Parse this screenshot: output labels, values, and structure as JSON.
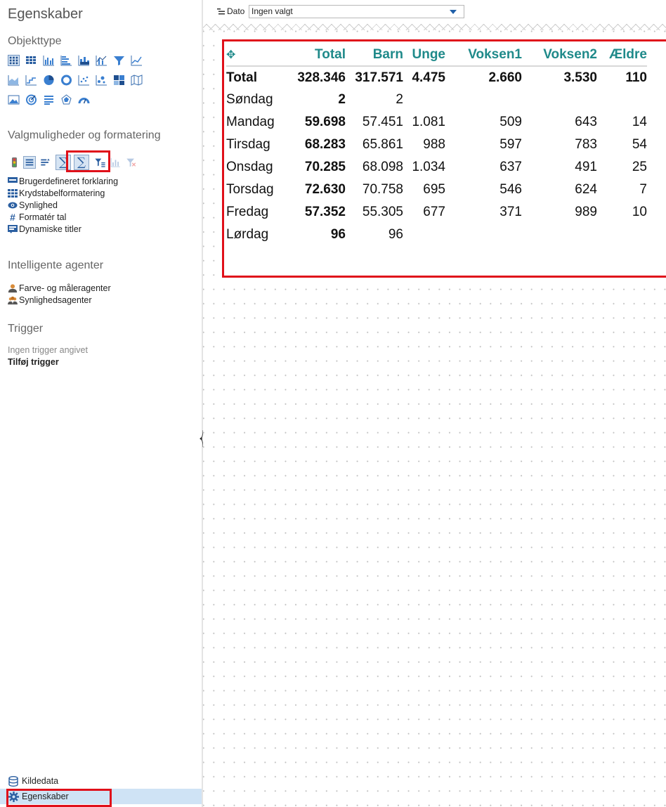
{
  "sidebar": {
    "title": "Egenskaber",
    "object_type_title": "Objekttype",
    "options_title": "Valgmuligheder og formatering",
    "links": [
      {
        "label": "Brugerdefineret forklaring",
        "icon": "legend-icon"
      },
      {
        "label": "Krydstabelformatering",
        "icon": "grid-icon"
      },
      {
        "label": "Synlighed",
        "icon": "eye-icon"
      },
      {
        "label": "Formatér tal",
        "icon": "hash-icon"
      },
      {
        "label": "Dynamiske titler",
        "icon": "titles-icon"
      }
    ],
    "agents_title": "Intelligente agenter",
    "agents": [
      {
        "label": "Farve- og måleragenter",
        "icon": "agent-icon"
      },
      {
        "label": "Synlighedsagenter",
        "icon": "agents-group-icon"
      }
    ],
    "trigger_title": "Trigger",
    "trigger_empty": "Ingen trigger angivet",
    "trigger_add": "Tilføj trigger",
    "bottom_nav": [
      {
        "label": "Kildedata",
        "icon": "database-icon"
      },
      {
        "label": "Egenskaber",
        "icon": "gear-icon",
        "active": true
      }
    ]
  },
  "filter": {
    "label": "Dato",
    "value": "Ingen valgt"
  },
  "pivot": {
    "columns": [
      "Total",
      "Barn",
      "Unge",
      "Voksen1",
      "Voksen2",
      "Ældre"
    ],
    "rows": [
      {
        "label": "Total",
        "values": [
          "328.346",
          "317.571",
          "4.475",
          "2.660",
          "3.530",
          "110"
        ]
      },
      {
        "label": "Søndag",
        "values": [
          "2",
          "2",
          "",
          "",
          "",
          ""
        ]
      },
      {
        "label": "Mandag",
        "values": [
          "59.698",
          "57.451",
          "1.081",
          "509",
          "643",
          "14"
        ]
      },
      {
        "label": "Tirsdag",
        "values": [
          "68.283",
          "65.861",
          "988",
          "597",
          "783",
          "54"
        ]
      },
      {
        "label": "Onsdag",
        "values": [
          "70.285",
          "68.098",
          "1.034",
          "637",
          "491",
          "25"
        ]
      },
      {
        "label": "Torsdag",
        "values": [
          "72.630",
          "70.758",
          "695",
          "546",
          "624",
          "7"
        ]
      },
      {
        "label": "Fredag",
        "values": [
          "57.352",
          "55.305",
          "677",
          "371",
          "989",
          "10"
        ]
      },
      {
        "label": "Lørdag",
        "values": [
          "96",
          "96",
          "",
          "",
          "",
          ""
        ]
      }
    ]
  },
  "colors": {
    "header_text": "#1f8a8a",
    "highlight": "#e0101a",
    "active_nav": "#cfe3f5"
  }
}
